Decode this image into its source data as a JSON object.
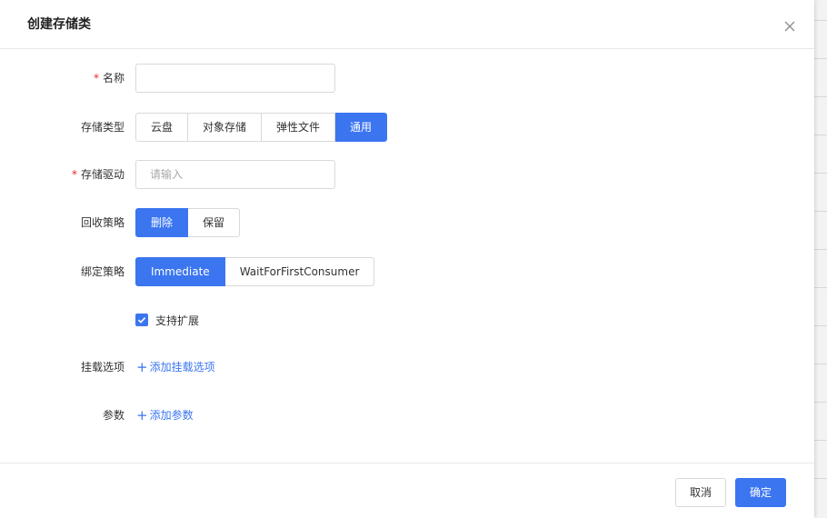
{
  "dialog": {
    "title": "创建存储类",
    "close_icon": "close-icon"
  },
  "form": {
    "name": {
      "label": "名称",
      "required_mark": "*",
      "value": "",
      "placeholder": ""
    },
    "storage_type": {
      "label": "存储类型",
      "options": [
        "云盘",
        "对象存储",
        "弹性文件",
        "通用"
      ],
      "selected": "通用"
    },
    "driver": {
      "label": "存储驱动",
      "required_mark": "*",
      "value": "",
      "placeholder": "请输入"
    },
    "reclaim_policy": {
      "label": "回收策略",
      "options": [
        "删除",
        "保留"
      ],
      "selected": "删除"
    },
    "binding_policy": {
      "label": "绑定策略",
      "options": [
        "Immediate",
        "WaitForFirstConsumer"
      ],
      "selected": "Immediate"
    },
    "expansion": {
      "label": "支持扩展",
      "checked": true
    },
    "mount_options": {
      "label": "挂载选项",
      "add_icon": "+",
      "add_label": "添加挂载选项"
    },
    "parameters": {
      "label": "参数",
      "add_icon": "+",
      "add_label": "添加参数"
    }
  },
  "footer": {
    "cancel_label": "取消",
    "ok_label": "确定"
  },
  "colors": {
    "accent": "#3b75f0",
    "required": "#f5222d"
  }
}
